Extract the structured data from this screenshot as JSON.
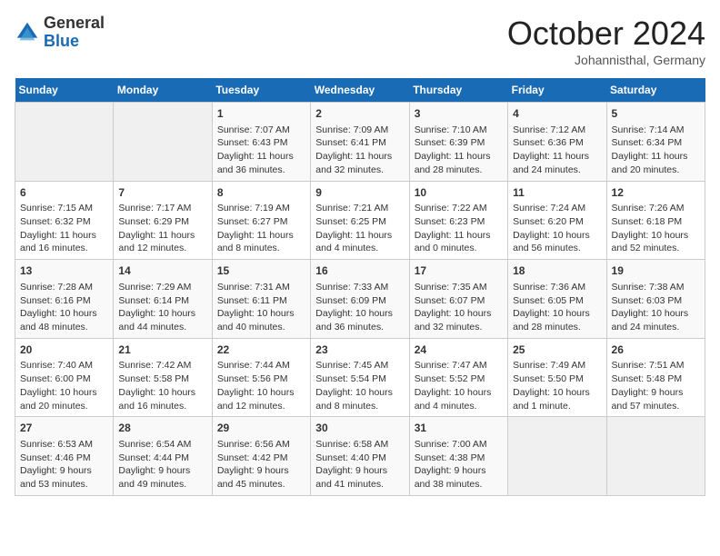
{
  "logo": {
    "general": "General",
    "blue": "Blue"
  },
  "title": "October 2024",
  "subtitle": "Johannisthal, Germany",
  "weekdays": [
    "Sunday",
    "Monday",
    "Tuesday",
    "Wednesday",
    "Thursday",
    "Friday",
    "Saturday"
  ],
  "weeks": [
    [
      {
        "day": "",
        "info": ""
      },
      {
        "day": "",
        "info": ""
      },
      {
        "day": "1",
        "info": "Sunrise: 7:07 AM\nSunset: 6:43 PM\nDaylight: 11 hours and 36 minutes."
      },
      {
        "day": "2",
        "info": "Sunrise: 7:09 AM\nSunset: 6:41 PM\nDaylight: 11 hours and 32 minutes."
      },
      {
        "day": "3",
        "info": "Sunrise: 7:10 AM\nSunset: 6:39 PM\nDaylight: 11 hours and 28 minutes."
      },
      {
        "day": "4",
        "info": "Sunrise: 7:12 AM\nSunset: 6:36 PM\nDaylight: 11 hours and 24 minutes."
      },
      {
        "day": "5",
        "info": "Sunrise: 7:14 AM\nSunset: 6:34 PM\nDaylight: 11 hours and 20 minutes."
      }
    ],
    [
      {
        "day": "6",
        "info": "Sunrise: 7:15 AM\nSunset: 6:32 PM\nDaylight: 11 hours and 16 minutes."
      },
      {
        "day": "7",
        "info": "Sunrise: 7:17 AM\nSunset: 6:29 PM\nDaylight: 11 hours and 12 minutes."
      },
      {
        "day": "8",
        "info": "Sunrise: 7:19 AM\nSunset: 6:27 PM\nDaylight: 11 hours and 8 minutes."
      },
      {
        "day": "9",
        "info": "Sunrise: 7:21 AM\nSunset: 6:25 PM\nDaylight: 11 hours and 4 minutes."
      },
      {
        "day": "10",
        "info": "Sunrise: 7:22 AM\nSunset: 6:23 PM\nDaylight: 11 hours and 0 minutes."
      },
      {
        "day": "11",
        "info": "Sunrise: 7:24 AM\nSunset: 6:20 PM\nDaylight: 10 hours and 56 minutes."
      },
      {
        "day": "12",
        "info": "Sunrise: 7:26 AM\nSunset: 6:18 PM\nDaylight: 10 hours and 52 minutes."
      }
    ],
    [
      {
        "day": "13",
        "info": "Sunrise: 7:28 AM\nSunset: 6:16 PM\nDaylight: 10 hours and 48 minutes."
      },
      {
        "day": "14",
        "info": "Sunrise: 7:29 AM\nSunset: 6:14 PM\nDaylight: 10 hours and 44 minutes."
      },
      {
        "day": "15",
        "info": "Sunrise: 7:31 AM\nSunset: 6:11 PM\nDaylight: 10 hours and 40 minutes."
      },
      {
        "day": "16",
        "info": "Sunrise: 7:33 AM\nSunset: 6:09 PM\nDaylight: 10 hours and 36 minutes."
      },
      {
        "day": "17",
        "info": "Sunrise: 7:35 AM\nSunset: 6:07 PM\nDaylight: 10 hours and 32 minutes."
      },
      {
        "day": "18",
        "info": "Sunrise: 7:36 AM\nSunset: 6:05 PM\nDaylight: 10 hours and 28 minutes."
      },
      {
        "day": "19",
        "info": "Sunrise: 7:38 AM\nSunset: 6:03 PM\nDaylight: 10 hours and 24 minutes."
      }
    ],
    [
      {
        "day": "20",
        "info": "Sunrise: 7:40 AM\nSunset: 6:00 PM\nDaylight: 10 hours and 20 minutes."
      },
      {
        "day": "21",
        "info": "Sunrise: 7:42 AM\nSunset: 5:58 PM\nDaylight: 10 hours and 16 minutes."
      },
      {
        "day": "22",
        "info": "Sunrise: 7:44 AM\nSunset: 5:56 PM\nDaylight: 10 hours and 12 minutes."
      },
      {
        "day": "23",
        "info": "Sunrise: 7:45 AM\nSunset: 5:54 PM\nDaylight: 10 hours and 8 minutes."
      },
      {
        "day": "24",
        "info": "Sunrise: 7:47 AM\nSunset: 5:52 PM\nDaylight: 10 hours and 4 minutes."
      },
      {
        "day": "25",
        "info": "Sunrise: 7:49 AM\nSunset: 5:50 PM\nDaylight: 10 hours and 1 minute."
      },
      {
        "day": "26",
        "info": "Sunrise: 7:51 AM\nSunset: 5:48 PM\nDaylight: 9 hours and 57 minutes."
      }
    ],
    [
      {
        "day": "27",
        "info": "Sunrise: 6:53 AM\nSunset: 4:46 PM\nDaylight: 9 hours and 53 minutes."
      },
      {
        "day": "28",
        "info": "Sunrise: 6:54 AM\nSunset: 4:44 PM\nDaylight: 9 hours and 49 minutes."
      },
      {
        "day": "29",
        "info": "Sunrise: 6:56 AM\nSunset: 4:42 PM\nDaylight: 9 hours and 45 minutes."
      },
      {
        "day": "30",
        "info": "Sunrise: 6:58 AM\nSunset: 4:40 PM\nDaylight: 9 hours and 41 minutes."
      },
      {
        "day": "31",
        "info": "Sunrise: 7:00 AM\nSunset: 4:38 PM\nDaylight: 9 hours and 38 minutes."
      },
      {
        "day": "",
        "info": ""
      },
      {
        "day": "",
        "info": ""
      }
    ]
  ]
}
